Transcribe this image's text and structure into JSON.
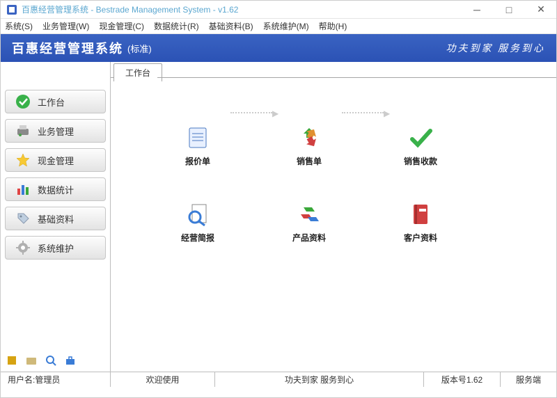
{
  "window": {
    "title": "百惠经营管理系统 - Bestrade Management System - v1.62"
  },
  "menu": {
    "items": [
      "系统(S)",
      "业务管理(W)",
      "现金管理(C)",
      "数据统计(R)",
      "基础资料(B)",
      "系统维护(M)",
      "帮助(H)"
    ]
  },
  "banner": {
    "title": "百惠经营管理系统",
    "edition": "(标准)",
    "slogan": "功夫到家 服务到心"
  },
  "sidebar": {
    "items": [
      {
        "label": "工作台",
        "icon": "check-icon"
      },
      {
        "label": "业务管理",
        "icon": "printer-icon"
      },
      {
        "label": "现金管理",
        "icon": "star-icon"
      },
      {
        "label": "数据统计",
        "icon": "chart-icon"
      },
      {
        "label": "基础资料",
        "icon": "tag-icon"
      },
      {
        "label": "系统维护",
        "icon": "gear-icon"
      }
    ]
  },
  "tab": {
    "label": "工作台"
  },
  "shortcuts": {
    "quote": "报价单",
    "sales": "销售单",
    "receipt": "销售收款",
    "report": "经营简报",
    "product": "产品资料",
    "customer": "客户资料"
  },
  "statusbar": {
    "user": "用户名:管理员",
    "welcome": "欢迎使用",
    "slogan": "功夫到家 服务到心",
    "version": "版本号1.62",
    "server": "服务端"
  }
}
